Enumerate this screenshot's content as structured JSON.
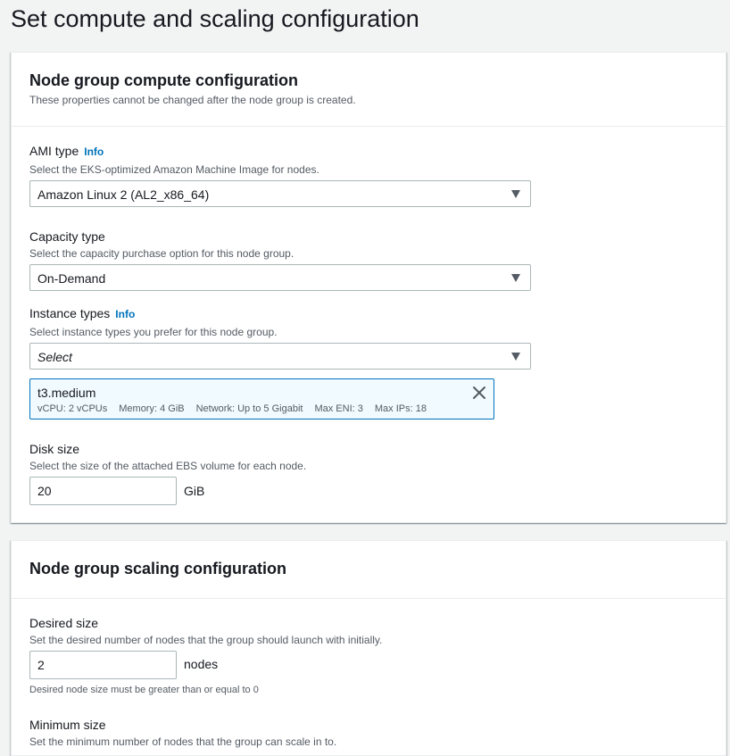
{
  "page": {
    "title": "Set compute and scaling configuration"
  },
  "compute": {
    "title": "Node group compute configuration",
    "description": "These properties cannot be changed after the node group is created.",
    "ami": {
      "label": "AMI type",
      "info": "Info",
      "description": "Select the EKS-optimized Amazon Machine Image for nodes.",
      "value": "Amazon Linux 2 (AL2_x86_64)"
    },
    "capacity": {
      "label": "Capacity type",
      "description": "Select the capacity purchase option for this node group.",
      "value": "On-Demand"
    },
    "instance_types": {
      "label": "Instance types",
      "info": "Info",
      "description": "Select instance types you prefer for this node group.",
      "placeholder": "Select",
      "selected": {
        "name": "t3.medium",
        "vcpu": "vCPU: 2 vCPUs",
        "memory": "Memory: 4 GiB",
        "network": "Network: Up to 5 Gigabit",
        "max_eni": "Max ENI: 3",
        "max_ips": "Max IPs: 18"
      }
    },
    "disk": {
      "label": "Disk size",
      "description": "Select the size of the attached EBS volume for each node.",
      "value": "20",
      "unit": "GiB"
    }
  },
  "scaling": {
    "title": "Node group scaling configuration",
    "desired": {
      "label": "Desired size",
      "description": "Set the desired number of nodes that the group should launch with initially.",
      "value": "2",
      "unit": "nodes",
      "constraint": "Desired node size must be greater than or equal to 0"
    },
    "minimum": {
      "label": "Minimum size",
      "description": "Set the minimum number of nodes that the group can scale in to."
    }
  },
  "icons": {
    "caret": "caret-down-icon",
    "close": "close-icon"
  },
  "colors": {
    "link": "#0073bb",
    "token_border": "#0073bb",
    "token_bg": "#f1faff"
  }
}
